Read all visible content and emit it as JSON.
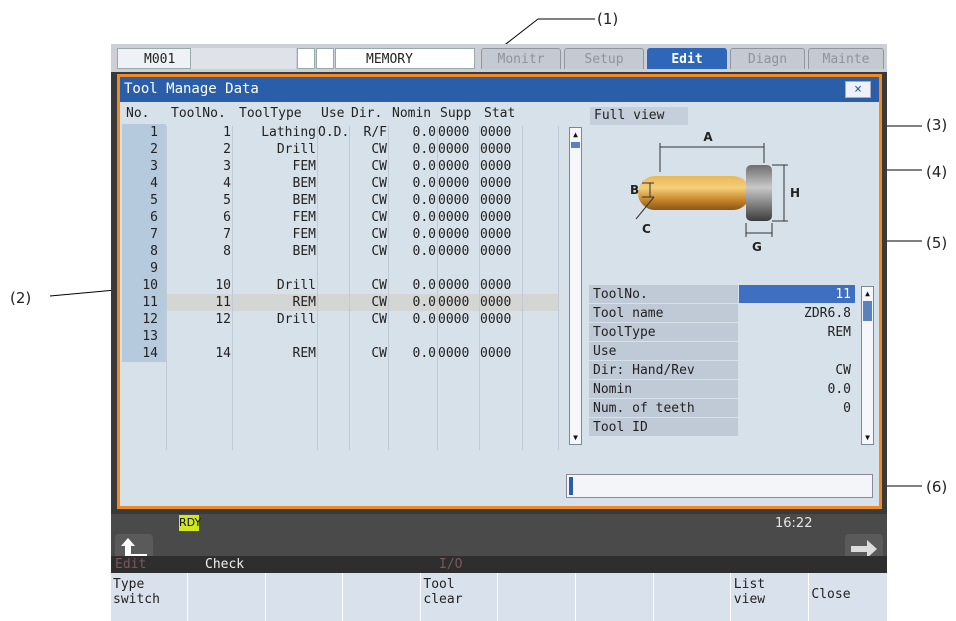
{
  "callouts": [
    "(1)",
    "(2)",
    "(3)",
    "(4)",
    "(5)",
    "(6)"
  ],
  "topbar": {
    "machine": "M001",
    "mode": "MEMORY",
    "tabs": [
      "Monitr",
      "Setup",
      "Edit",
      "Diagn",
      "Mainte"
    ],
    "active_tab": "Edit"
  },
  "window": {
    "title": "Tool Manage Data",
    "close": "×"
  },
  "table": {
    "headers": [
      "No.",
      "ToolNo.",
      "ToolType",
      "Use",
      "Dir.",
      "Nomin",
      "Supp",
      "Stat"
    ],
    "rows": [
      [
        "1",
        "1",
        "Lathing",
        "O.D.",
        "R/F",
        "0.0",
        "0000",
        "0000"
      ],
      [
        "2",
        "2",
        "Drill",
        "",
        "CW",
        "0.0",
        "0000",
        "0000"
      ],
      [
        "3",
        "3",
        "FEM",
        "",
        "CW",
        "0.0",
        "0000",
        "0000"
      ],
      [
        "4",
        "4",
        "BEM",
        "",
        "CW",
        "0.0",
        "0000",
        "0000"
      ],
      [
        "5",
        "5",
        "BEM",
        "",
        "CW",
        "0.0",
        "0000",
        "0000"
      ],
      [
        "6",
        "6",
        "FEM",
        "",
        "CW",
        "0.0",
        "0000",
        "0000"
      ],
      [
        "7",
        "7",
        "FEM",
        "",
        "CW",
        "0.0",
        "0000",
        "0000"
      ],
      [
        "8",
        "8",
        "BEM",
        "",
        "CW",
        "0.0",
        "0000",
        "0000"
      ],
      [
        "9",
        "",
        "",
        "",
        "",
        "",
        "",
        ""
      ],
      [
        "10",
        "10",
        "Drill",
        "",
        "CW",
        "0.0",
        "0000",
        "0000"
      ],
      [
        "11",
        "11",
        "REM",
        "",
        "CW",
        "0.0",
        "0000",
        "0000"
      ],
      [
        "12",
        "12",
        "Drill",
        "",
        "CW",
        "0.0",
        "0000",
        "0000"
      ],
      [
        "13",
        "",
        "",
        "",
        "",
        "",
        "",
        ""
      ],
      [
        "14",
        "14",
        "REM",
        "",
        "CW",
        "0.0",
        "0000",
        "0000"
      ]
    ],
    "selected_row": 11
  },
  "fullview": "Full view",
  "diagram_labels": {
    "a": "A",
    "b": "B",
    "c": "C",
    "g": "G",
    "h": "H"
  },
  "details": [
    {
      "label": "ToolNo.",
      "value": "11"
    },
    {
      "label": "Tool name",
      "value": "ZDR6.8"
    },
    {
      "label": "ToolType",
      "value": "REM"
    },
    {
      "label": "Use",
      "value": ""
    },
    {
      "label": "Dir: Hand/Rev",
      "value": "CW"
    },
    {
      "label": "Nomin",
      "value": "0.0"
    },
    {
      "label": "Num. of teeth",
      "value": "0"
    },
    {
      "label": "Tool ID",
      "value": ""
    }
  ],
  "status": {
    "rdy": "RDY",
    "time": "16:22"
  },
  "menu": [
    "Edit",
    "Check",
    "I/O"
  ],
  "softkeys": [
    "Type\nswitch",
    "",
    "",
    "",
    "Tool\nclear",
    "",
    "",
    "",
    "List\nview",
    "Close"
  ],
  "colors": {
    "accent": "#2a5ea8",
    "frame": "#ef8b26",
    "active_tab": "#2e66b8",
    "rdy": "#cfe820"
  }
}
